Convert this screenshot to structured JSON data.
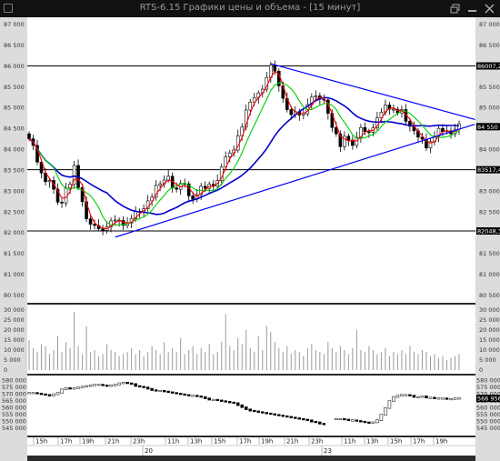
{
  "window": {
    "title": "RTS-6.15 Графики цены и объема - [15 минут]"
  },
  "icons": [
    "app-icon",
    "restore-icon",
    "minimize-icon",
    "close-icon"
  ],
  "price_panel": {
    "y_ticks": [
      "87 000",
      "86 500",
      "86 000",
      "85 500",
      "85 000",
      "84 500",
      "84 000",
      "83 500",
      "83 000",
      "82 500",
      "82 000",
      "81 500",
      "81 000",
      "80 500"
    ],
    "tags": [
      {
        "text": "86007,2",
        "color": "#000000"
      },
      {
        "text": "84 550",
        "color": "#000000"
      },
      {
        "text": "83517,4",
        "color": "#000000"
      },
      {
        "text": "82048,3",
        "color": "#000000"
      }
    ]
  },
  "volume_panel": {
    "y_ticks": [
      "30 000",
      "25 000",
      "20 000",
      "15 000",
      "10 000",
      "5 000",
      "0"
    ]
  },
  "oi_panel": {
    "y_ticks": [
      "580 000",
      "575 000",
      "570 000",
      "565 000",
      "560 000",
      "555 000",
      "550 000",
      "545 000"
    ],
    "tag": "566 956"
  },
  "time_axis": {
    "hours": [
      "15h",
      "17h",
      "19h",
      "21h",
      "23h",
      "11h",
      "13h",
      "15h",
      "17h",
      "19h",
      "21h",
      "23h",
      "11h",
      "13h",
      "15h",
      "17h",
      "19h"
    ],
    "dates": [
      "20",
      "23"
    ]
  },
  "chart_data": {
    "type": "candlestick",
    "title": "RTS-6.15 Графики цены и объема - [15 минут]",
    "timeframe": "15 минут",
    "y_range": [
      80500,
      87000
    ],
    "levels": [
      86007.2,
      83517.4,
      82048.3
    ],
    "current_price": 84550,
    "close": [
      84260,
      84100,
      83700,
      83440,
      83230,
      83260,
      83050,
      82740,
      82720,
      83080,
      83170,
      83620,
      83090,
      82750,
      82340,
      82210,
      82180,
      82100,
      82060,
      82150,
      82290,
      82310,
      82300,
      82180,
      82240,
      82350,
      82520,
      82500,
      82580,
      82770,
      82860,
      83140,
      83180,
      83270,
      83360,
      83080,
      83050,
      83190,
      83180,
      82890,
      82810,
      82920,
      83120,
      83070,
      83170,
      83120,
      83260,
      83580,
      83830,
      83920,
      83990,
      84330,
      84540,
      84950,
      85140,
      85250,
      85360,
      85450,
      85730,
      86020,
      85880,
      85530,
      85230,
      84960,
      84840,
      84910,
      84830,
      84860,
      85080,
      85260,
      85290,
      85210,
      85190,
      84870,
      84530,
      84380,
      84070,
      84320,
      84230,
      84100,
      84290,
      84530,
      84430,
      84420,
      84520,
      84760,
      84900,
      85070,
      84970,
      84970,
      84880,
      84960,
      84680,
      84560,
      84450,
      84300,
      84250,
      84040,
      84190,
      84320,
      84510,
      84430,
      84450,
      84380,
      84490,
      84620
    ],
    "ma_fast_color": "#00cc00",
    "ma_mid_color": "#ff0000",
    "ma_slow_color": "#0000cc",
    "trendlines": [
      {
        "from": [
          21,
          81900
        ],
        "to": [
          106,
          84520
        ],
        "color": "#0000ff"
      },
      {
        "from": [
          59,
          86060
        ],
        "to": [
          106,
          84800
        ],
        "color": "#0000ff"
      }
    ],
    "volume": [
      15000,
      11000,
      9000,
      13000,
      12000,
      8000,
      10000,
      17000,
      9000,
      14000,
      11000,
      29000,
      12000,
      8000,
      22000,
      9000,
      10000,
      7000,
      8000,
      13000,
      10000,
      9000,
      7000,
      8000,
      9000,
      11000,
      8000,
      10000,
      7000,
      9000,
      12000,
      10000,
      8000,
      14000,
      9000,
      11000,
      9000,
      16000,
      8000,
      10000,
      12000,
      8000,
      11000,
      9000,
      13000,
      8000,
      9000,
      14000,
      28000,
      12000,
      10000,
      16000,
      13000,
      20000,
      11000,
      9000,
      17000,
      10000,
      22000,
      19000,
      14000,
      11000,
      9000,
      12000,
      8000,
      10000,
      9000,
      7000,
      11000,
      13000,
      10000,
      9000,
      8000,
      14000,
      11000,
      9000,
      12000,
      10000,
      8000,
      11000,
      20000,
      10000,
      9000,
      12000,
      10000,
      8000,
      9000,
      11000,
      7000,
      9000,
      8000,
      10000,
      8000,
      12000,
      9000,
      8000,
      10000,
      9000,
      7000,
      8000,
      6000,
      7000,
      5000,
      6000,
      7000,
      8000
    ],
    "open_interest": [
      571000,
      571000,
      570500,
      570000,
      569500,
      569000,
      570000,
      571000,
      573500,
      574500,
      574000,
      574500,
      575000,
      575500,
      576000,
      576500,
      577000,
      577000,
      576500,
      576000,
      576500,
      577000,
      578000,
      578500,
      578000,
      577500,
      576000,
      575500,
      575000,
      574000,
      573000,
      572500,
      572500,
      572000,
      571500,
      571000,
      570500,
      570000,
      569500,
      569000,
      569000,
      568500,
      568000,
      567000,
      566000,
      566000,
      565500,
      565000,
      564500,
      564000,
      563500,
      562000,
      560500,
      559000,
      558000,
      557500,
      557000,
      556500,
      556000,
      555500,
      555000,
      554500,
      554000,
      553500,
      553000,
      552500,
      552000,
      551500,
      551000,
      550000,
      549500,
      548500,
      548000,
      null,
      null,
      552000,
      552000,
      551500,
      551000,
      551000,
      550500,
      550000,
      549500,
      549000,
      549500,
      551000,
      555000,
      560000,
      565000,
      568000,
      569000,
      569500,
      569500,
      569000,
      568000,
      568000,
      568500,
      567500,
      567500,
      567000,
      567000,
      567000,
      566500,
      566500,
      567000,
      567000
    ]
  }
}
